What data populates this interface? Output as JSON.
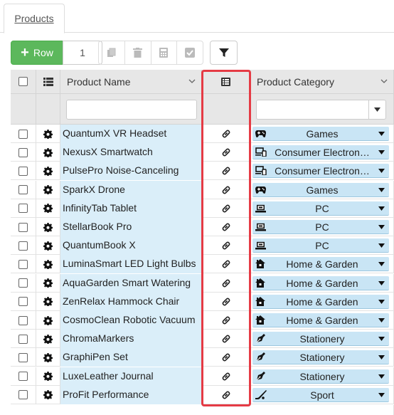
{
  "tabs": [
    {
      "label": "Products"
    }
  ],
  "toolbar": {
    "add_row_label": "Row",
    "row_count": "1",
    "icons": [
      "copy-icon",
      "trash-icon",
      "calculator-icon",
      "check-square-icon",
      "filter-icon"
    ]
  },
  "grid": {
    "columns": {
      "name": "Product Name",
      "category": "Product Category"
    },
    "filters": {
      "name_value": "",
      "category_value": ""
    },
    "rows": [
      {
        "name": "QuantumX VR Headset",
        "category": "Games",
        "category_icon": "gamepad-icon"
      },
      {
        "name": "NexusX Smartwatch",
        "category": "Consumer Electron…",
        "category_icon": "devices-icon"
      },
      {
        "name": "PulsePro Noise-Canceling",
        "category": "Consumer Electron…",
        "category_icon": "devices-icon"
      },
      {
        "name": "SparkX Drone",
        "category": "Games",
        "category_icon": "gamepad-icon"
      },
      {
        "name": "InfinityTab Tablet",
        "category": "PC",
        "category_icon": "laptop-icon"
      },
      {
        "name": "StellarBook Pro",
        "category": "PC",
        "category_icon": "laptop-icon"
      },
      {
        "name": "QuantumBook X",
        "category": "PC",
        "category_icon": "laptop-icon"
      },
      {
        "name": "LuminaSmart LED Light Bulbs",
        "category": "Home & Garden",
        "category_icon": "house-icon"
      },
      {
        "name": "AquaGarden Smart Watering",
        "category": "Home & Garden",
        "category_icon": "house-icon"
      },
      {
        "name": "ZenRelax Hammock Chair",
        "category": "Home & Garden",
        "category_icon": "house-icon"
      },
      {
        "name": "CosmoClean Robotic Vacuum",
        "category": "Home & Garden",
        "category_icon": "house-icon"
      },
      {
        "name": "ChromaMarkers",
        "category": "Stationery",
        "category_icon": "pen-icon"
      },
      {
        "name": "GraphiPen Set",
        "category": "Stationery",
        "category_icon": "pen-icon"
      },
      {
        "name": "LuxeLeather Journal",
        "category": "Stationery",
        "category_icon": "pen-icon"
      },
      {
        "name": "ProFit Performance",
        "category": "Sport",
        "category_icon": "hockey-stick-icon"
      }
    ]
  },
  "colors": {
    "accent_green": "#5cb85c",
    "row_highlight": "#daeef9",
    "category_pill": "#c9e5f5",
    "highlight_border": "#e53b45"
  }
}
